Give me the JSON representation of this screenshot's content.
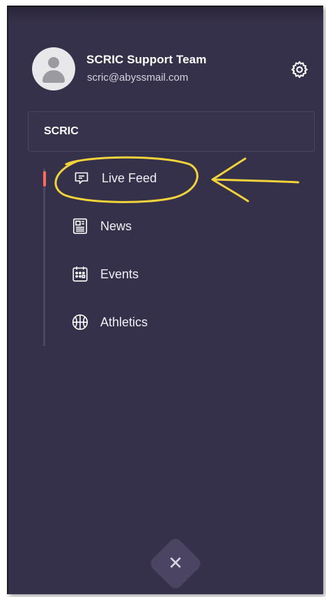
{
  "user": {
    "name": "SCRIC Support Team",
    "email": "scric@abyssmail.com"
  },
  "section": {
    "title": "SCRIC"
  },
  "nav": {
    "items": [
      {
        "label": "Live Feed",
        "icon": "chat-icon",
        "active": true
      },
      {
        "label": "News",
        "icon": "newspaper-icon",
        "active": false
      },
      {
        "label": "Events",
        "icon": "calendar-icon",
        "active": false
      },
      {
        "label": "Athletics",
        "icon": "basketball-icon",
        "active": false
      }
    ]
  },
  "icons": {
    "settings": "gear-icon",
    "close": "close-icon",
    "avatar": "user-avatar-icon"
  },
  "close_glyph": "✕",
  "colors": {
    "background": "#36314a",
    "active_indicator": "#ff6b5a",
    "annotation": "#f2d33a",
    "text": "#ffffff"
  }
}
